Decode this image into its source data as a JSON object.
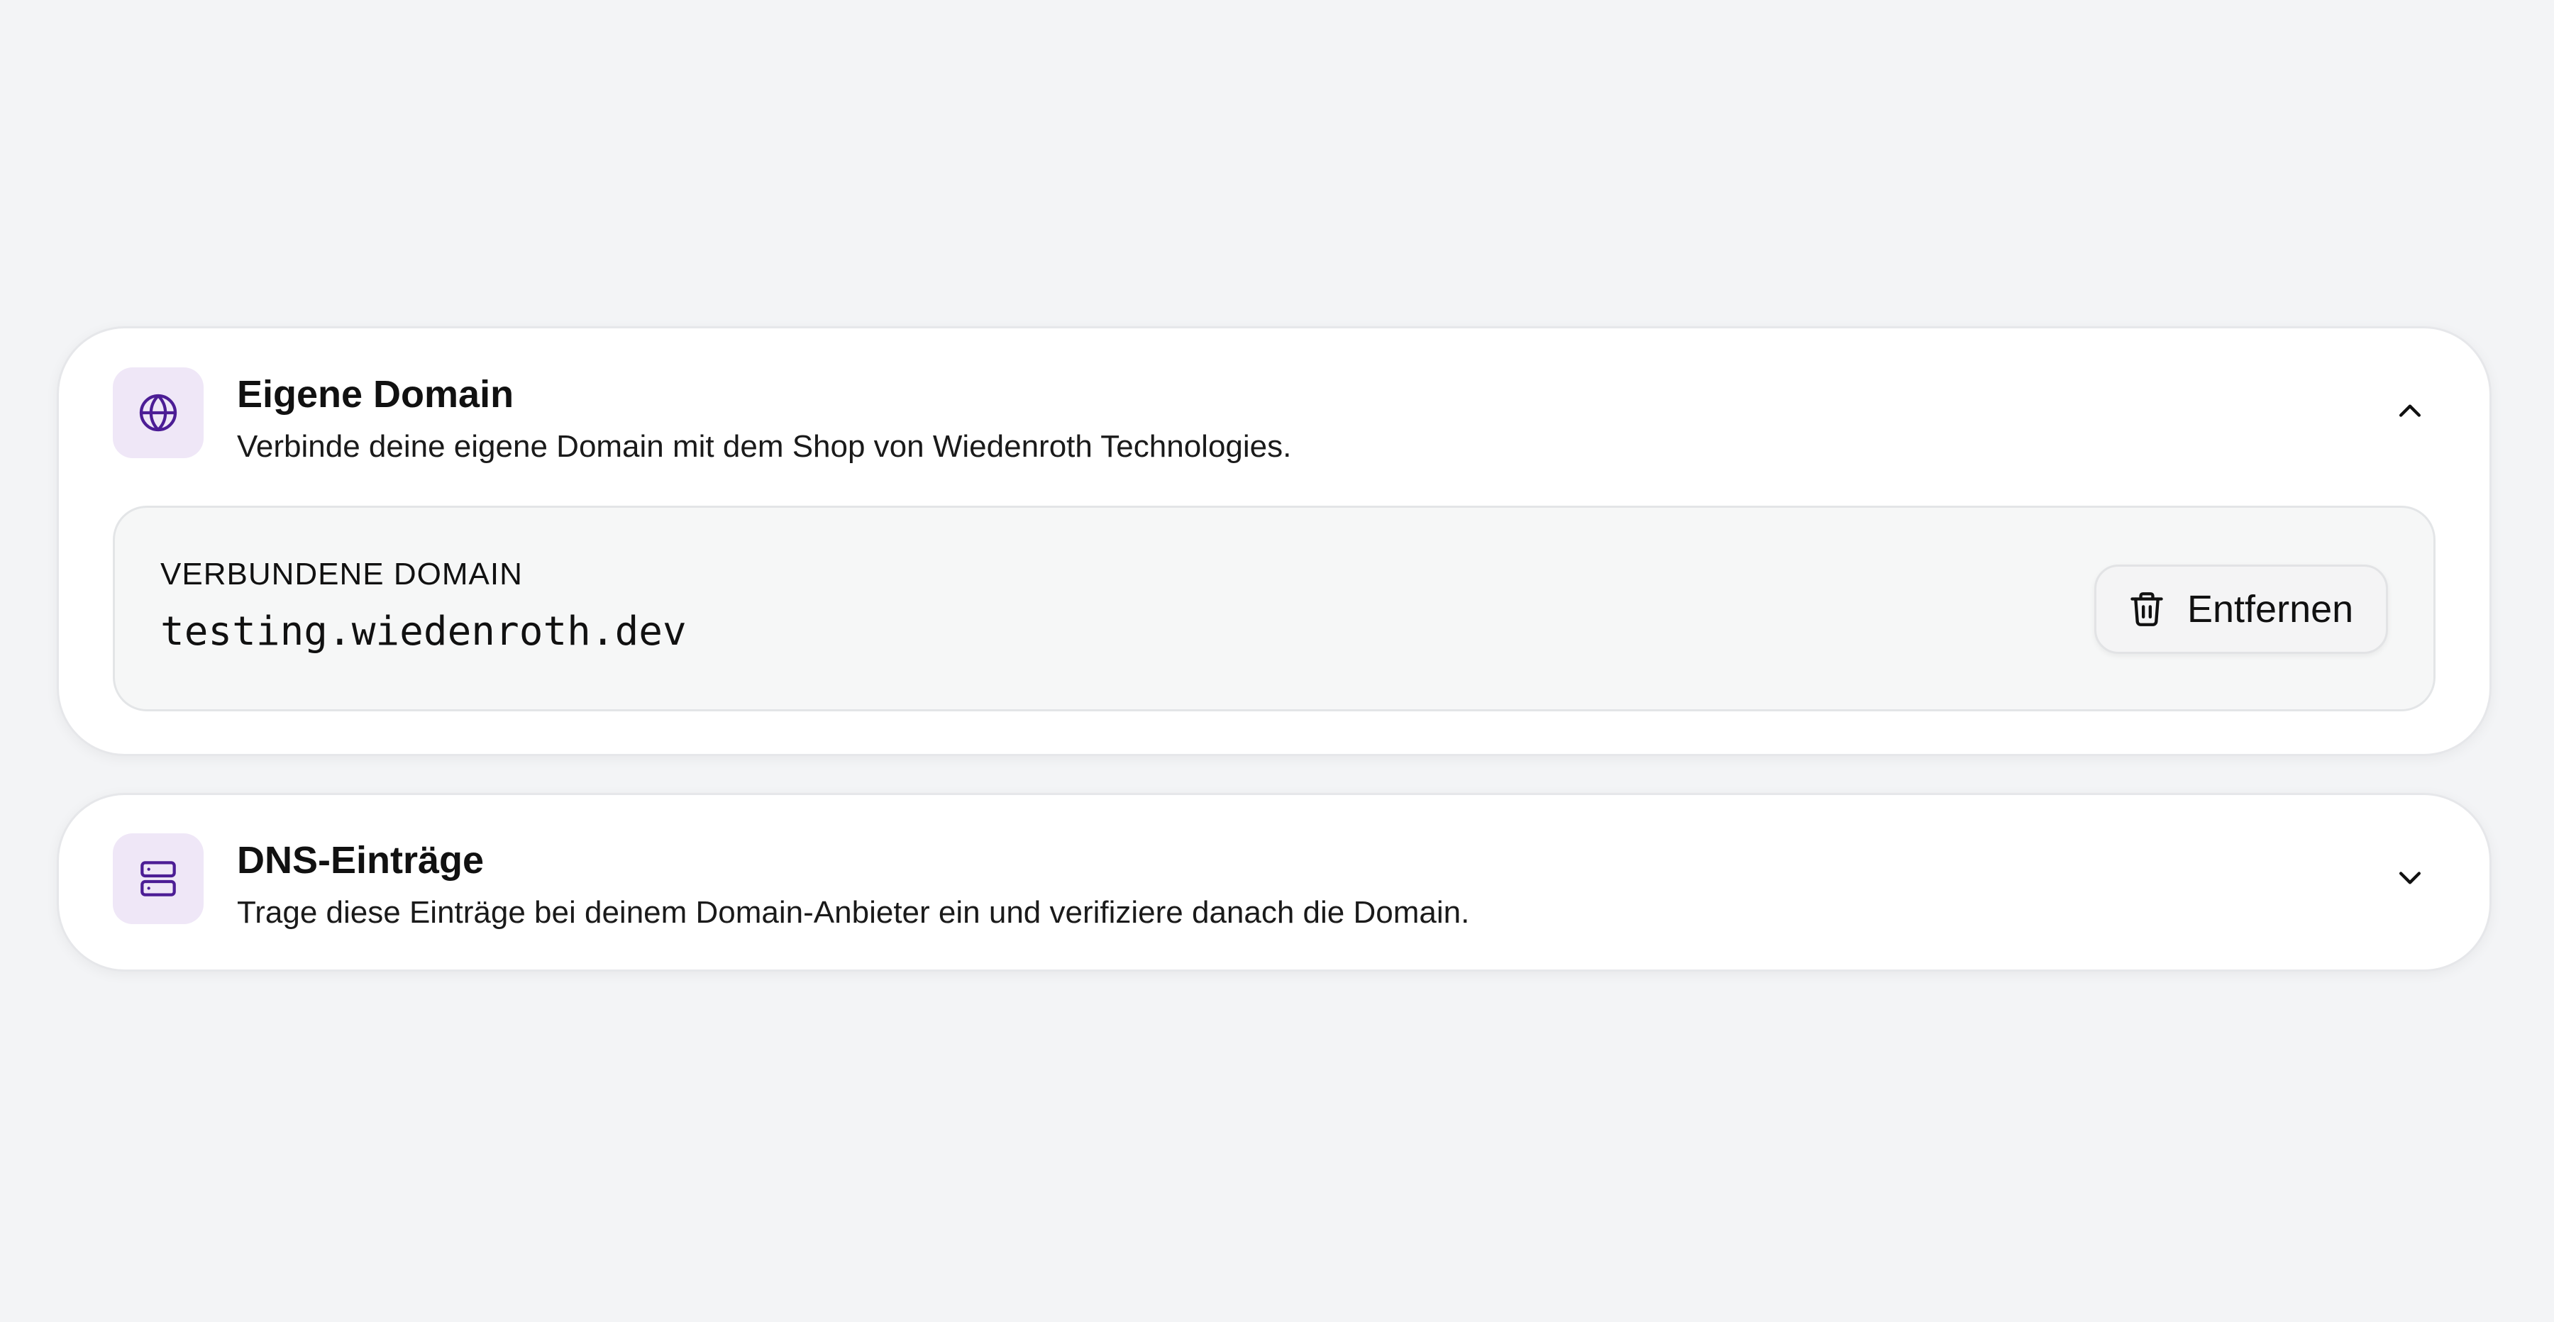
{
  "accent_color": "#4c1d95",
  "icon_tile_color": "#efe7f7",
  "custom_domain": {
    "icon": "globe-icon",
    "title": "Eigene Domain",
    "description": "Verbinde deine eigene Domain mit dem Shop von Wiedenroth Technologies.",
    "expanded": true,
    "toggle_icon": "chevron-up-icon",
    "connected_label": "VERBUNDENE DOMAIN",
    "connected_value": "testing.wiedenroth.dev",
    "remove_button": {
      "icon": "trash-icon",
      "label": "Entfernen"
    }
  },
  "dns_records": {
    "icon": "server-icon",
    "title": "DNS-Einträge",
    "description": "Trage diese Einträge bei deinem Domain-Anbieter ein und verifiziere danach die Domain.",
    "expanded": false,
    "toggle_icon": "chevron-down-icon"
  }
}
